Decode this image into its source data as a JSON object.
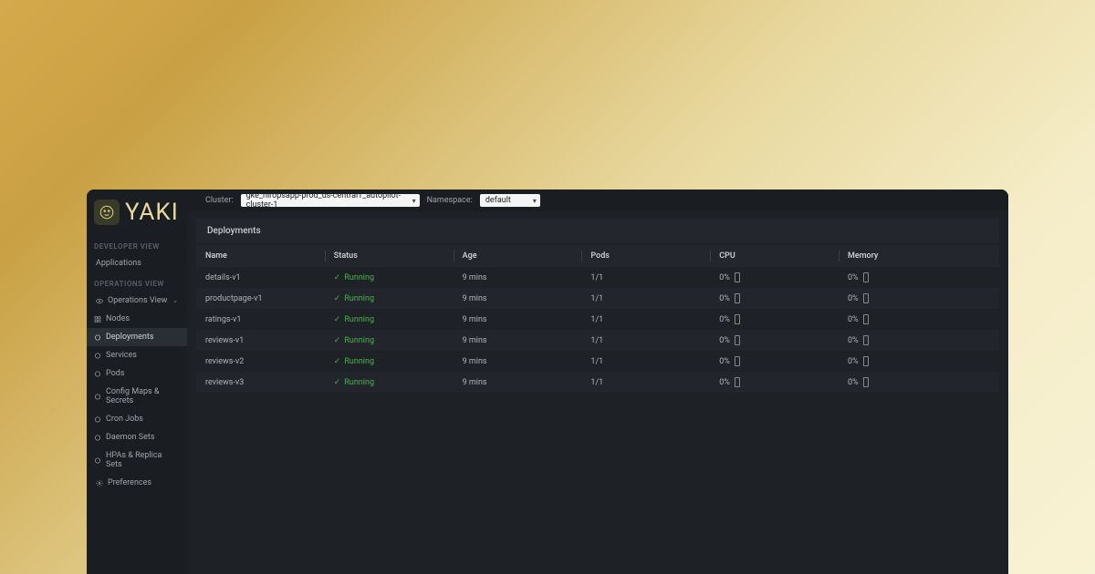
{
  "app": {
    "name": "YAKI"
  },
  "sidebar": {
    "dev_label": "DEVELOPER VIEW",
    "applications": "Applications",
    "ops_label": "OPERATIONS VIEW",
    "ops_view": "Operations View",
    "items": [
      {
        "label": "Nodes",
        "icon": "nodes"
      },
      {
        "label": "Deployments",
        "icon": "circle"
      },
      {
        "label": "Services",
        "icon": "circle"
      },
      {
        "label": "Pods",
        "icon": "circle"
      },
      {
        "label": "Config Maps & Secrets",
        "icon": "circle"
      },
      {
        "label": "Cron Jobs",
        "icon": "circle"
      },
      {
        "label": "Daemon Sets",
        "icon": "circle"
      },
      {
        "label": "HPAs & Replica Sets",
        "icon": "circle"
      }
    ],
    "preferences": "Preferences"
  },
  "topbar": {
    "cluster_label": "Cluster:",
    "cluster_value": "gke_niropsapp-prod_us-central1_autopilot-cluster-1",
    "namespace_label": "Namespace:",
    "namespace_value": "default"
  },
  "page": {
    "title": "Deployments"
  },
  "table": {
    "headers": {
      "name": "Name",
      "status": "Status",
      "age": "Age",
      "pods": "Pods",
      "cpu": "CPU",
      "memory": "Memory"
    },
    "rows": [
      {
        "name": "details-v1",
        "status": "Running",
        "age": "9 mins",
        "pods": "1/1",
        "cpu": "0%",
        "memory": "0%"
      },
      {
        "name": "productpage-v1",
        "status": "Running",
        "age": "9 mins",
        "pods": "1/1",
        "cpu": "0%",
        "memory": "0%"
      },
      {
        "name": "ratings-v1",
        "status": "Running",
        "age": "9 mins",
        "pods": "1/1",
        "cpu": "0%",
        "memory": "0%"
      },
      {
        "name": "reviews-v1",
        "status": "Running",
        "age": "9 mins",
        "pods": "1/1",
        "cpu": "0%",
        "memory": "0%"
      },
      {
        "name": "reviews-v2",
        "status": "Running",
        "age": "9 mins",
        "pods": "1/1",
        "cpu": "0%",
        "memory": "0%"
      },
      {
        "name": "reviews-v3",
        "status": "Running",
        "age": "9 mins",
        "pods": "1/1",
        "cpu": "0%",
        "memory": "0%"
      }
    ]
  }
}
